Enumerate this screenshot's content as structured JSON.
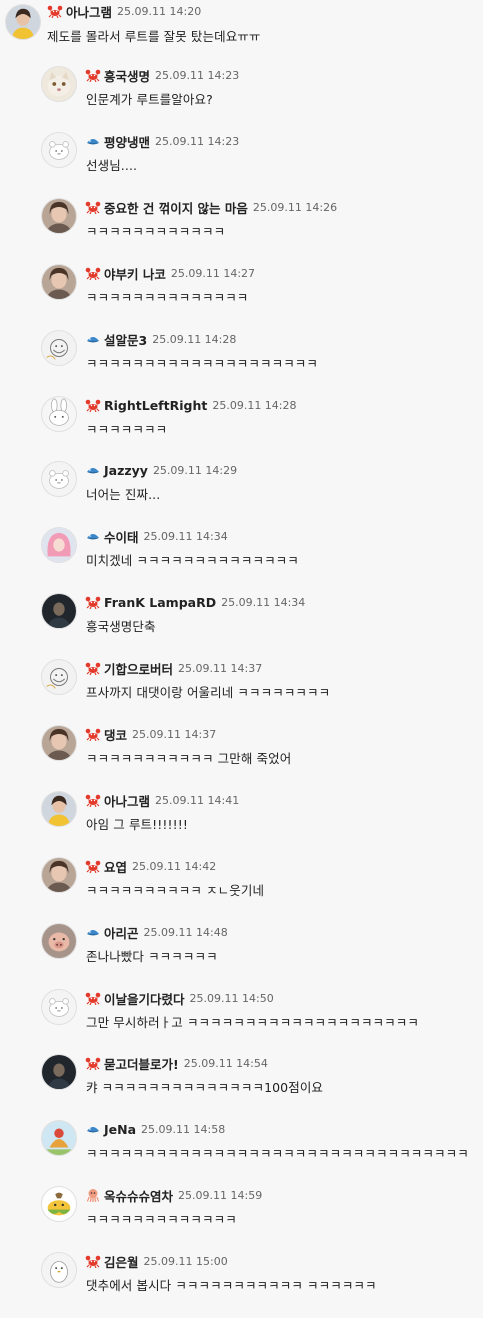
{
  "colors": {
    "crab": "#e33a2c",
    "fish": "#3a86c8",
    "octopus": "#f09a80",
    "background": "#f7f7f7"
  },
  "comments": [
    {
      "name": "아나그램",
      "time": "25.09.11 14:20",
      "text": "제도를 몰라서 루트를 잘못 탔는데요ㅠㅠ",
      "badge": "crab-icon",
      "avatar": "woman-yellow-avatar"
    },
    {
      "name": "흥국생명",
      "time": "25.09.11 14:23",
      "text": "인문계가 루트를알아요?",
      "badge": "crab-icon",
      "avatar": "cat-avatar"
    },
    {
      "name": "평양냉맨",
      "time": "25.09.11 14:23",
      "text": "선생님....",
      "badge": "fish-icon",
      "avatar": "default-avatar"
    },
    {
      "name": "중요한 건 꺾이지 않는 마음",
      "time": "25.09.11 14:26",
      "text": "ㅋㅋㅋㅋㅋㅋㅋㅋㅋㅋㅋㅋ",
      "badge": "crab-icon",
      "avatar": "photo-avatar"
    },
    {
      "name": "야부키 나코",
      "time": "25.09.11 14:27",
      "text": "ㅋㅋㅋㅋㅋㅋㅋㅋㅋㅋㅋㅋㅋㅋ",
      "badge": "crab-icon",
      "avatar": "photo-avatar"
    },
    {
      "name": "설알문3",
      "time": "25.09.11 14:28",
      "text": "ㅋㅋㅋㅋㅋㅋㅋㅋㅋㅋㅋㅋㅋㅋㅋㅋㅋㅋㅋㅋ",
      "badge": "fish-icon",
      "avatar": "sketch-avatar"
    },
    {
      "name": "RightLeftRight",
      "time": "25.09.11 14:28",
      "text": "ㅋㅋㅋㅋㅋㅋㅋ",
      "badge": "crab-icon",
      "avatar": "rabbit-avatar"
    },
    {
      "name": "Jazzyy",
      "time": "25.09.11 14:29",
      "text": "너어는 진짜...",
      "badge": "fish-icon",
      "avatar": "default-avatar"
    },
    {
      "name": "수이태",
      "time": "25.09.11 14:34",
      "text": "미치겠네 ㅋㅋㅋㅋㅋㅋㅋㅋㅋㅋㅋㅋㅋㅋ",
      "badge": "fish-icon",
      "avatar": "pink-hair-avatar"
    },
    {
      "name": "FranK LampaRD",
      "time": "25.09.11 14:34",
      "text": "흥국생명단축",
      "badge": "crab-icon",
      "avatar": "dark-photo-avatar"
    },
    {
      "name": "기합으로버터",
      "time": "25.09.11 14:37",
      "text": "프사까지 대댓이랑 어울리네 ㅋㅋㅋㅋㅋㅋㅋㅋ",
      "badge": "crab-icon",
      "avatar": "sketch-avatar"
    },
    {
      "name": "댕코",
      "time": "25.09.11 14:37",
      "text": "ㅋㅋㅋㅋㅋㅋㅋㅋㅋㅋㅋ 그만해 죽었어",
      "badge": "crab-icon",
      "avatar": "photo-avatar"
    },
    {
      "name": "아나그램",
      "time": "25.09.11 14:41",
      "text": "아임 그 루트!!!!!!!",
      "badge": "crab-icon",
      "avatar": "woman-yellow-avatar"
    },
    {
      "name": "요엽",
      "time": "25.09.11 14:42",
      "text": "ㅋㅋㅋㅋㅋㅋㅋㅋㅋㅋ ㅈㄴ웃기네",
      "badge": "crab-icon",
      "avatar": "photo-avatar"
    },
    {
      "name": "아리곤",
      "time": "25.09.11 14:48",
      "text": "존나나빴다 ㅋㅋㅋㅋㅋㅋ",
      "badge": "fish-icon",
      "avatar": "pig-avatar"
    },
    {
      "name": "이날을기다렸다",
      "time": "25.09.11 14:50",
      "text": "그만 무시하러ㅏ고 ㅋㅋㅋㅋㅋㅋㅋㅋㅋㅋㅋㅋㅋㅋㅋㅋㅋㅋㅋㅋ",
      "badge": "crab-icon",
      "avatar": "default-avatar"
    },
    {
      "name": "묻고더블로가!",
      "time": "25.09.11 14:54",
      "text": "캬 ㅋㅋㅋㅋㅋㅋㅋㅋㅋㅋㅋㅋㅋㅋ100점이요",
      "badge": "crab-icon",
      "avatar": "dark-photo-avatar"
    },
    {
      "name": "JeNa",
      "time": "25.09.11 14:58",
      "text": "ㅋㅋㅋㅋㅋㅋㅋㅋㅋㅋㅋㅋㅋㅋㅋㅋㅋㅋㅋㅋㅋㅋㅋㅋㅋㅋㅋㅋㅋㅋㅋㅋㅋ",
      "badge": "fish-icon",
      "avatar": "illustration-avatar"
    },
    {
      "name": "옥슈슈슈염차",
      "time": "25.09.11 14:59",
      "text": "ㅋㅋㅋㅋㅋㅋㅋㅋㅋㅋㅋㅋㅋ",
      "badge": "octopus-icon",
      "avatar": "corn-avatar"
    },
    {
      "name": "김은월",
      "time": "25.09.11 15:00",
      "text": "댓추에서 봅시다 ㅋㅋㅋㅋㅋㅋㅋㅋㅋㅋㅋ ㅋㅋㅋㅋㅋㅋ",
      "badge": "crab-icon",
      "avatar": "penguin-avatar"
    }
  ]
}
